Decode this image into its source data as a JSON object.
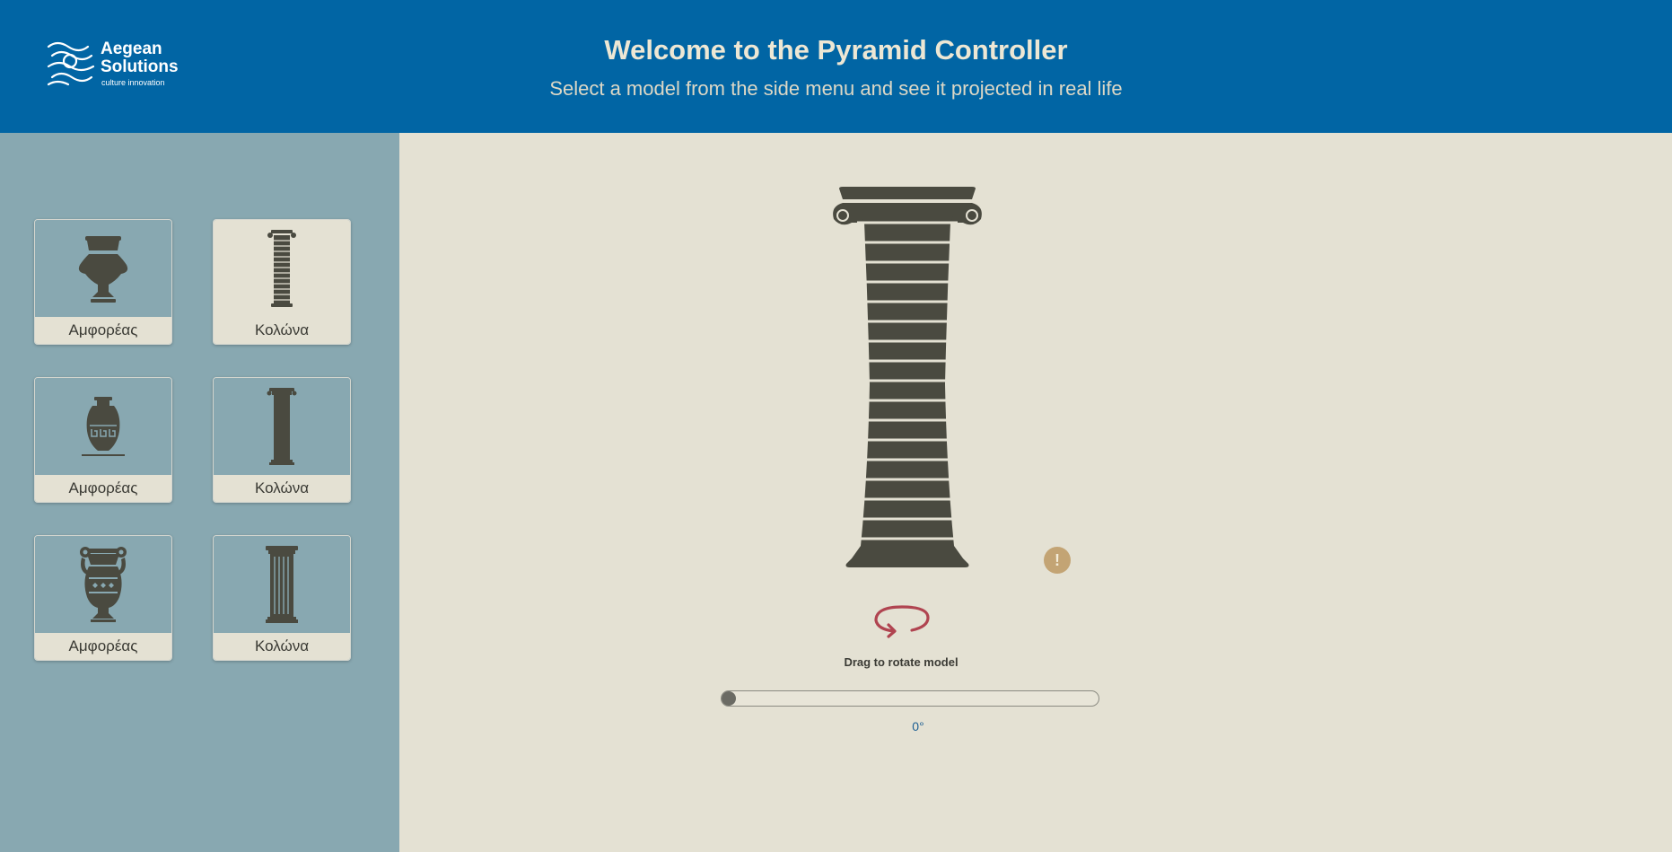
{
  "header": {
    "logo_name": "Aegean\nSolutions",
    "logo_tagline": "culture innovation",
    "title": "Welcome to the Pyramid Controller",
    "subtitle": "Select a model from the side menu and see it projected in real life"
  },
  "sidebar": {
    "models": [
      {
        "label": "Αμφορέας",
        "icon": "krater-icon"
      },
      {
        "label": "Κολώνα",
        "icon": "ionic-column-icon",
        "selected": true
      },
      {
        "label": "Αμφορέας",
        "icon": "amphora-icon"
      },
      {
        "label": "Κολώνα",
        "icon": "doric-column-icon"
      },
      {
        "label": "Αμφορέας",
        "icon": "volute-krater-icon"
      },
      {
        "label": "Κολώνα",
        "icon": "fluted-column-icon"
      }
    ]
  },
  "viewer": {
    "model_icon": "ionic-column-model",
    "info_icon": "!",
    "rotate_hint": "Drag to rotate model",
    "rotation_label": "0°",
    "rotation_fraction": 0
  },
  "colors": {
    "header_bg": "#0165a4",
    "sidebar_bg": "#88a8b1",
    "main_bg": "#e4e1d3",
    "model_fill": "#4a4a40",
    "accent_red": "#b04450",
    "info_gold": "#c3a474"
  }
}
